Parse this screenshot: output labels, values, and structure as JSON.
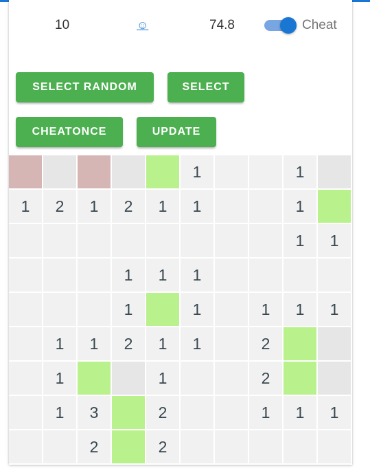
{
  "header": {
    "mine_counter": "10",
    "smiley": "☺",
    "timer": "74.8",
    "cheat_label": "Cheat",
    "cheat_enabled": true
  },
  "buttons": {
    "select_random": "SELECT RANDOM",
    "select": "SELECT",
    "cheat_once": "CHEATONCE",
    "update": "UPDATE"
  },
  "colors": {
    "accent": "#1976d2",
    "button": "#4caf50",
    "revealed": "#f1f1f1",
    "hidden": "#e6e6e6",
    "safe_hint": "#b9f18d",
    "mine_hint": "#d5b6b4"
  },
  "board": {
    "legend": {
      "o": "revealed",
      "h": "hidden",
      "g": "safe-hint",
      "r": "mine-hint"
    },
    "rows": [
      {
        "states": [
          "r",
          "h",
          "r",
          "h",
          "g",
          "o",
          "o",
          "o",
          "o",
          "h"
        ],
        "values": [
          "",
          "",
          "",
          "",
          "",
          "1",
          "",
          "",
          "1",
          ""
        ]
      },
      {
        "states": [
          "o",
          "o",
          "o",
          "o",
          "o",
          "o",
          "o",
          "o",
          "o",
          "g"
        ],
        "values": [
          "1",
          "2",
          "1",
          "2",
          "1",
          "1",
          "",
          "",
          "1",
          ""
        ]
      },
      {
        "states": [
          "o",
          "o",
          "o",
          "o",
          "o",
          "o",
          "o",
          "o",
          "o",
          "o"
        ],
        "values": [
          "",
          "",
          "",
          "",
          "",
          "",
          "",
          "",
          "1",
          "1"
        ]
      },
      {
        "states": [
          "o",
          "o",
          "o",
          "o",
          "o",
          "o",
          "o",
          "o",
          "o",
          "o"
        ],
        "values": [
          "",
          "",
          "",
          "1",
          "1",
          "1",
          "",
          "",
          "",
          ""
        ]
      },
      {
        "states": [
          "o",
          "o",
          "o",
          "o",
          "g",
          "o",
          "o",
          "o",
          "o",
          "o"
        ],
        "values": [
          "",
          "",
          "",
          "1",
          "",
          "1",
          "",
          "1",
          "1",
          "1"
        ]
      },
      {
        "states": [
          "o",
          "o",
          "o",
          "o",
          "o",
          "o",
          "o",
          "o",
          "g",
          "h"
        ],
        "values": [
          "",
          "1",
          "1",
          "2",
          "1",
          "1",
          "",
          "2",
          "",
          ""
        ]
      },
      {
        "states": [
          "o",
          "o",
          "g",
          "h",
          "o",
          "o",
          "o",
          "o",
          "g",
          "h"
        ],
        "values": [
          "",
          "1",
          "",
          "",
          "1",
          "",
          "",
          "2",
          "",
          ""
        ]
      },
      {
        "states": [
          "o",
          "o",
          "o",
          "g",
          "o",
          "o",
          "o",
          "o",
          "o",
          "o"
        ],
        "values": [
          "",
          "1",
          "3",
          "",
          "2",
          "",
          "",
          "1",
          "1",
          "1"
        ]
      },
      {
        "states": [
          "o",
          "o",
          "o",
          "g",
          "o",
          "o",
          "o",
          "o",
          "o",
          "o"
        ],
        "values": [
          "",
          "",
          "2",
          "",
          "2",
          "",
          "",
          "",
          "",
          ""
        ]
      }
    ]
  }
}
